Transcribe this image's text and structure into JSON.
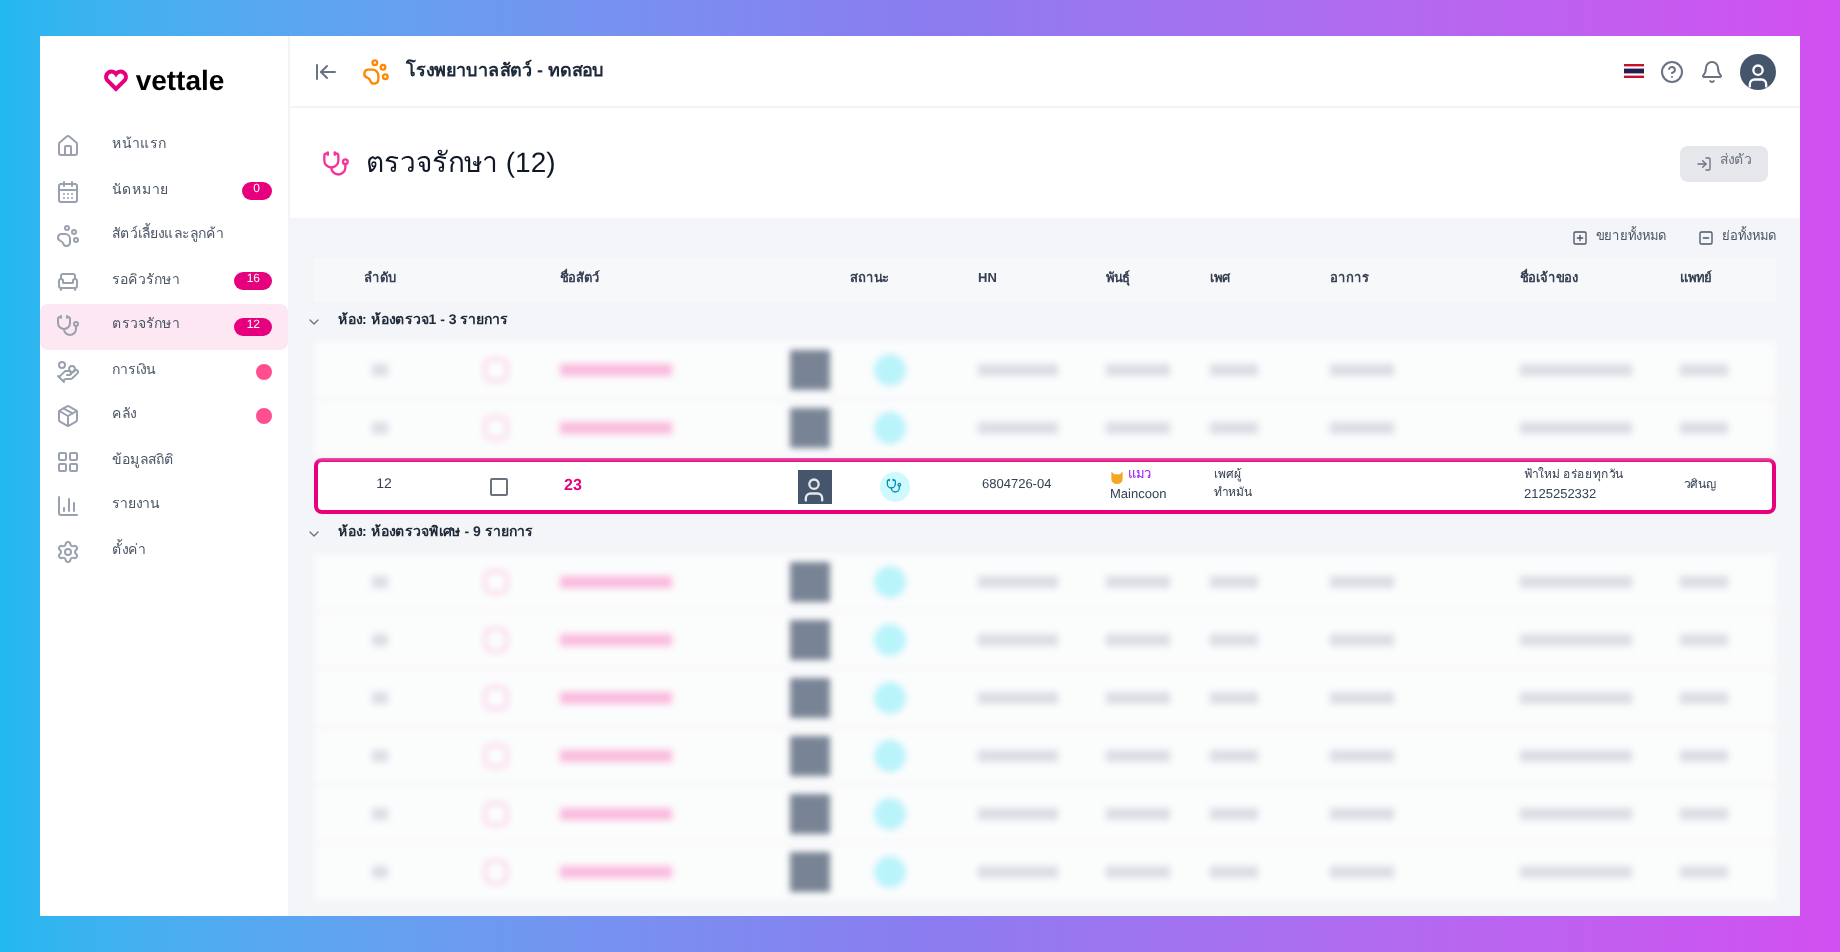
{
  "sidebar": {
    "logo": "vettale",
    "items": [
      {
        "label": "หน้าแรก",
        "selected": false
      },
      {
        "label": "นัดหมาย",
        "selected": false,
        "badge": "0"
      },
      {
        "label": "สัตว์เลี้ยงและลูกค้า",
        "selected": false
      },
      {
        "label": "รอคิวรักษา",
        "selected": false,
        "badge": "16"
      },
      {
        "label": "ตรวจรักษา",
        "selected": true,
        "badge": "12"
      },
      {
        "label": "การเงิน",
        "selected": false,
        "dot": true
      },
      {
        "label": "คลัง",
        "selected": false,
        "dot": true
      },
      {
        "label": "ข้อมูลสถิติ",
        "selected": false
      },
      {
        "label": "รายงาน",
        "selected": false
      },
      {
        "label": "ตั้งค่า",
        "selected": false
      }
    ]
  },
  "header": {
    "clinic": "โรงพยาบาลสัตว์ - ทดสอบ"
  },
  "page": {
    "title": "ตรวจรักษา (12)",
    "button": "ส่งตัว",
    "expand_all": "ขยายทั้งหมด",
    "collapse_all": "ย่อทั้งหมด"
  },
  "table": {
    "columns": [
      "ลำดับ",
      "ชื่อสัตว์",
      "สถานะ",
      "HN",
      "พันธุ์",
      "เพศ",
      "อาการ",
      "ชื่อเจ้าของ",
      "แพทย์"
    ],
    "groups": [
      {
        "label": "ห้อง: ห้องตรวจ1 - 3 รายการ",
        "expanded": true,
        "rows": [
          {
            "no": "12",
            "checked": false,
            "pet": "23",
            "hn": "6804726-04",
            "species": "แมว",
            "breed": "Maincoon",
            "sex": "เพศผู้",
            "neuter": "ทำหมัน",
            "owner": "ฟ้าใหม่ อร่อยทุกวัน",
            "phone": "2125252332",
            "doctor": "วศินญ",
            "highlighted": true
          }
        ]
      },
      {
        "label": "ห้อง: ห้องตรวจพิเศษ - 9 รายการ",
        "expanded": true
      }
    ]
  }
}
